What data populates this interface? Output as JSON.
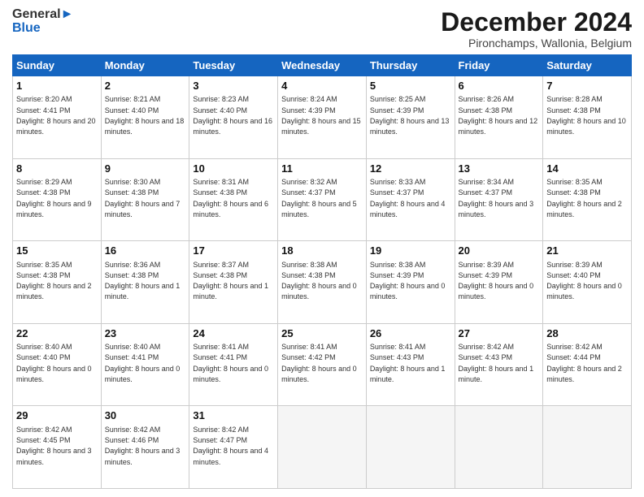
{
  "header": {
    "logo_general": "General",
    "logo_blue": "Blue",
    "month_title": "December 2024",
    "subtitle": "Pironchamps, Wallonia, Belgium"
  },
  "days_of_week": [
    "Sunday",
    "Monday",
    "Tuesday",
    "Wednesday",
    "Thursday",
    "Friday",
    "Saturday"
  ],
  "weeks": [
    [
      {
        "day": "1",
        "sunrise": "8:20 AM",
        "sunset": "4:41 PM",
        "daylight": "8 hours and 20 minutes."
      },
      {
        "day": "2",
        "sunrise": "8:21 AM",
        "sunset": "4:40 PM",
        "daylight": "8 hours and 18 minutes."
      },
      {
        "day": "3",
        "sunrise": "8:23 AM",
        "sunset": "4:40 PM",
        "daylight": "8 hours and 16 minutes."
      },
      {
        "day": "4",
        "sunrise": "8:24 AM",
        "sunset": "4:39 PM",
        "daylight": "8 hours and 15 minutes."
      },
      {
        "day": "5",
        "sunrise": "8:25 AM",
        "sunset": "4:39 PM",
        "daylight": "8 hours and 13 minutes."
      },
      {
        "day": "6",
        "sunrise": "8:26 AM",
        "sunset": "4:38 PM",
        "daylight": "8 hours and 12 minutes."
      },
      {
        "day": "7",
        "sunrise": "8:28 AM",
        "sunset": "4:38 PM",
        "daylight": "8 hours and 10 minutes."
      }
    ],
    [
      {
        "day": "8",
        "sunrise": "8:29 AM",
        "sunset": "4:38 PM",
        "daylight": "8 hours and 9 minutes."
      },
      {
        "day": "9",
        "sunrise": "8:30 AM",
        "sunset": "4:38 PM",
        "daylight": "8 hours and 7 minutes."
      },
      {
        "day": "10",
        "sunrise": "8:31 AM",
        "sunset": "4:38 PM",
        "daylight": "8 hours and 6 minutes."
      },
      {
        "day": "11",
        "sunrise": "8:32 AM",
        "sunset": "4:37 PM",
        "daylight": "8 hours and 5 minutes."
      },
      {
        "day": "12",
        "sunrise": "8:33 AM",
        "sunset": "4:37 PM",
        "daylight": "8 hours and 4 minutes."
      },
      {
        "day": "13",
        "sunrise": "8:34 AM",
        "sunset": "4:37 PM",
        "daylight": "8 hours and 3 minutes."
      },
      {
        "day": "14",
        "sunrise": "8:35 AM",
        "sunset": "4:38 PM",
        "daylight": "8 hours and 2 minutes."
      }
    ],
    [
      {
        "day": "15",
        "sunrise": "8:35 AM",
        "sunset": "4:38 PM",
        "daylight": "8 hours and 2 minutes."
      },
      {
        "day": "16",
        "sunrise": "8:36 AM",
        "sunset": "4:38 PM",
        "daylight": "8 hours and 1 minute."
      },
      {
        "day": "17",
        "sunrise": "8:37 AM",
        "sunset": "4:38 PM",
        "daylight": "8 hours and 1 minute."
      },
      {
        "day": "18",
        "sunrise": "8:38 AM",
        "sunset": "4:38 PM",
        "daylight": "8 hours and 0 minutes."
      },
      {
        "day": "19",
        "sunrise": "8:38 AM",
        "sunset": "4:39 PM",
        "daylight": "8 hours and 0 minutes."
      },
      {
        "day": "20",
        "sunrise": "8:39 AM",
        "sunset": "4:39 PM",
        "daylight": "8 hours and 0 minutes."
      },
      {
        "day": "21",
        "sunrise": "8:39 AM",
        "sunset": "4:40 PM",
        "daylight": "8 hours and 0 minutes."
      }
    ],
    [
      {
        "day": "22",
        "sunrise": "8:40 AM",
        "sunset": "4:40 PM",
        "daylight": "8 hours and 0 minutes."
      },
      {
        "day": "23",
        "sunrise": "8:40 AM",
        "sunset": "4:41 PM",
        "daylight": "8 hours and 0 minutes."
      },
      {
        "day": "24",
        "sunrise": "8:41 AM",
        "sunset": "4:41 PM",
        "daylight": "8 hours and 0 minutes."
      },
      {
        "day": "25",
        "sunrise": "8:41 AM",
        "sunset": "4:42 PM",
        "daylight": "8 hours and 0 minutes."
      },
      {
        "day": "26",
        "sunrise": "8:41 AM",
        "sunset": "4:43 PM",
        "daylight": "8 hours and 1 minute."
      },
      {
        "day": "27",
        "sunrise": "8:42 AM",
        "sunset": "4:43 PM",
        "daylight": "8 hours and 1 minute."
      },
      {
        "day": "28",
        "sunrise": "8:42 AM",
        "sunset": "4:44 PM",
        "daylight": "8 hours and 2 minutes."
      }
    ],
    [
      {
        "day": "29",
        "sunrise": "8:42 AM",
        "sunset": "4:45 PM",
        "daylight": "8 hours and 3 minutes."
      },
      {
        "day": "30",
        "sunrise": "8:42 AM",
        "sunset": "4:46 PM",
        "daylight": "8 hours and 3 minutes."
      },
      {
        "day": "31",
        "sunrise": "8:42 AM",
        "sunset": "4:47 PM",
        "daylight": "8 hours and 4 minutes."
      },
      null,
      null,
      null,
      null
    ]
  ]
}
